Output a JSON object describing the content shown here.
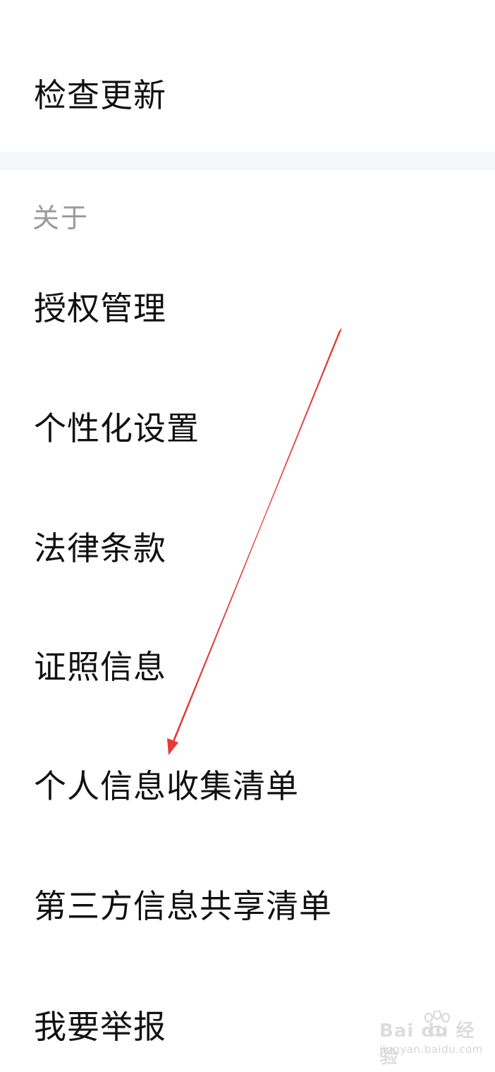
{
  "settings": {
    "check_update_label": "检查更新",
    "about_section_title": "关于",
    "items": [
      {
        "label": "授权管理"
      },
      {
        "label": "个性化设置"
      },
      {
        "label": "法律条款"
      },
      {
        "label": "证照信息"
      },
      {
        "label": "个人信息收集清单"
      },
      {
        "label": "第三方信息共享清单"
      },
      {
        "label": "我要举报"
      }
    ]
  },
  "annotation": {
    "arrow_color": "#e53935"
  },
  "watermark": {
    "logo_text": "Bai du 经验",
    "url": "jingyan.baidu.com"
  },
  "colors": {
    "background": "#ffffff",
    "divider": "#f5f6f8",
    "section_header": "#9a9a9a",
    "text": "#111111"
  }
}
